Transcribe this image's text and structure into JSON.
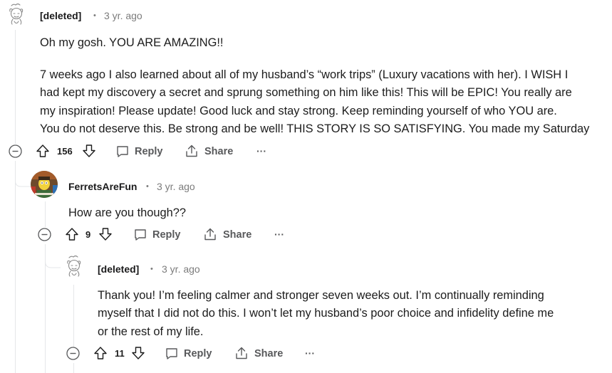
{
  "comments": [
    {
      "author": "[deleted]",
      "sep": "•",
      "time": "3 yr. ago",
      "lines": [
        "Oh my gosh. YOU ARE AMAZING!!",
        "7 weeks ago I also learned about all of my husband’s “work trips” (Luxury vacations with her). I WISH I",
        "had kept my discovery a secret and sprung something on him like this! This will be EPIC! You really are",
        "my inspiration! Please update! Good luck and stay strong. Keep reminding yourself of who YOU are.",
        "You do not deserve this. Be strong and be well! THIS STORY IS SO SATISFYING. You made my Saturday"
      ],
      "votes": "156",
      "reply": "Reply",
      "share": "Share",
      "more": "···"
    },
    {
      "author": "FerretsAreFun",
      "sep": "•",
      "time": "3 yr. ago",
      "lines": [
        "How are you though??"
      ],
      "votes": "9",
      "reply": "Reply",
      "share": "Share",
      "more": "···"
    },
    {
      "author": "[deleted]",
      "sep": "•",
      "time": "3 yr. ago",
      "lines": [
        "Thank you! I’m feeling calmer and stronger seven weeks out. I’m continually reminding",
        "myself that I did not do this. I won’t let my husband’s poor choice and infidelity define me",
        "or the rest of my life."
      ],
      "votes": "11",
      "reply": "Reply",
      "share": "Share",
      "more": "···"
    }
  ],
  "colors": {
    "text": "#1c1c1c",
    "meta": "#7c7c7c",
    "action": "#58595b",
    "thread_line": "#e5e7e9"
  },
  "icons": [
    "snoo-avatar-icon",
    "collapse-icon",
    "upvote-icon",
    "downvote-icon",
    "reply-icon",
    "share-icon",
    "more-icon"
  ]
}
